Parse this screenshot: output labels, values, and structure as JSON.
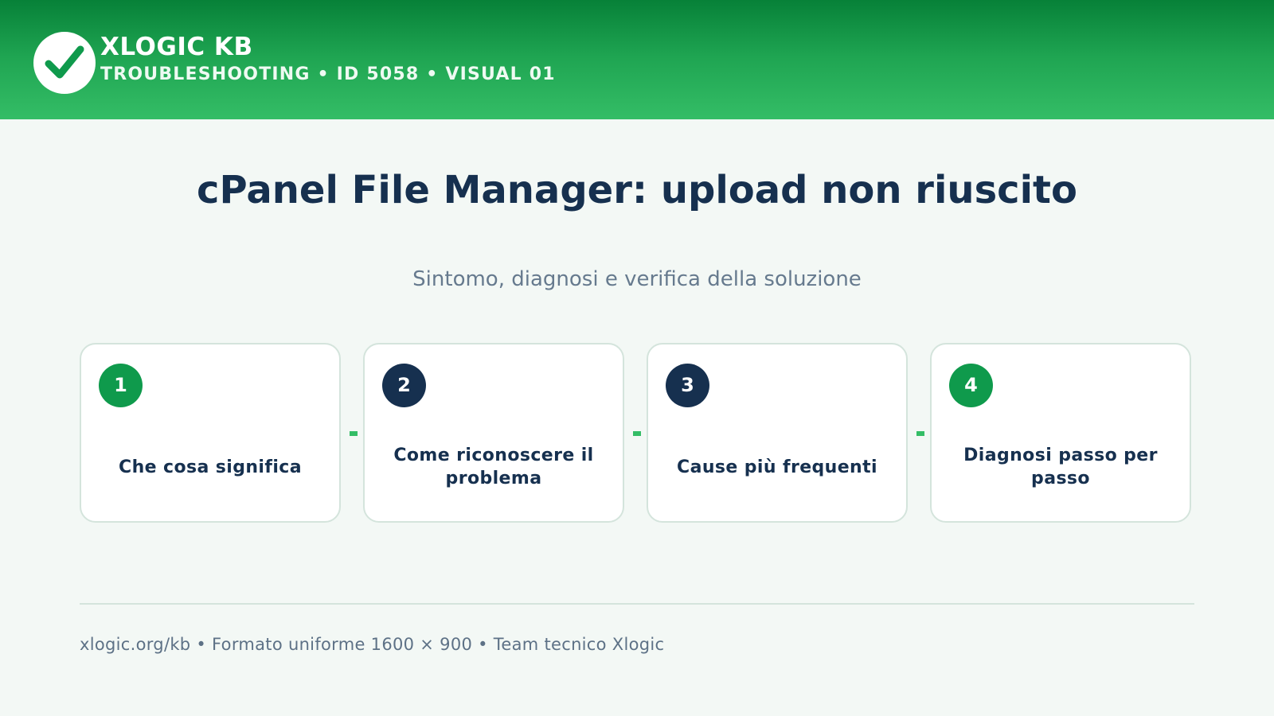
{
  "header": {
    "brand": "XLOGIC KB",
    "meta": "TROUBLESHOOTING • ID 5058 • VISUAL 01",
    "logo_icon": "checkmark-icon"
  },
  "main": {
    "title": "cPanel File Manager: upload non riuscito",
    "subtitle": "Sintomo, diagnosi e verifica della soluzione"
  },
  "steps": [
    {
      "number": "1",
      "label": "Che cosa significa",
      "badge_color": "#0f9a4c"
    },
    {
      "number": "2",
      "label": "Come riconoscere il problema",
      "badge_color": "#16304f"
    },
    {
      "number": "3",
      "label": "Cause più frequenti",
      "badge_color": "#16304f"
    },
    {
      "number": "4",
      "label": "Diagnosi passo per passo",
      "badge_color": "#0f9a4c"
    }
  ],
  "footer": {
    "text": "xlogic.org/kb • Formato uniforme 1600 × 900 • Team tecnico Xlogic"
  },
  "colors": {
    "accent_green": "#1fa552",
    "navy": "#16304f",
    "background": "#f3f8f5"
  }
}
